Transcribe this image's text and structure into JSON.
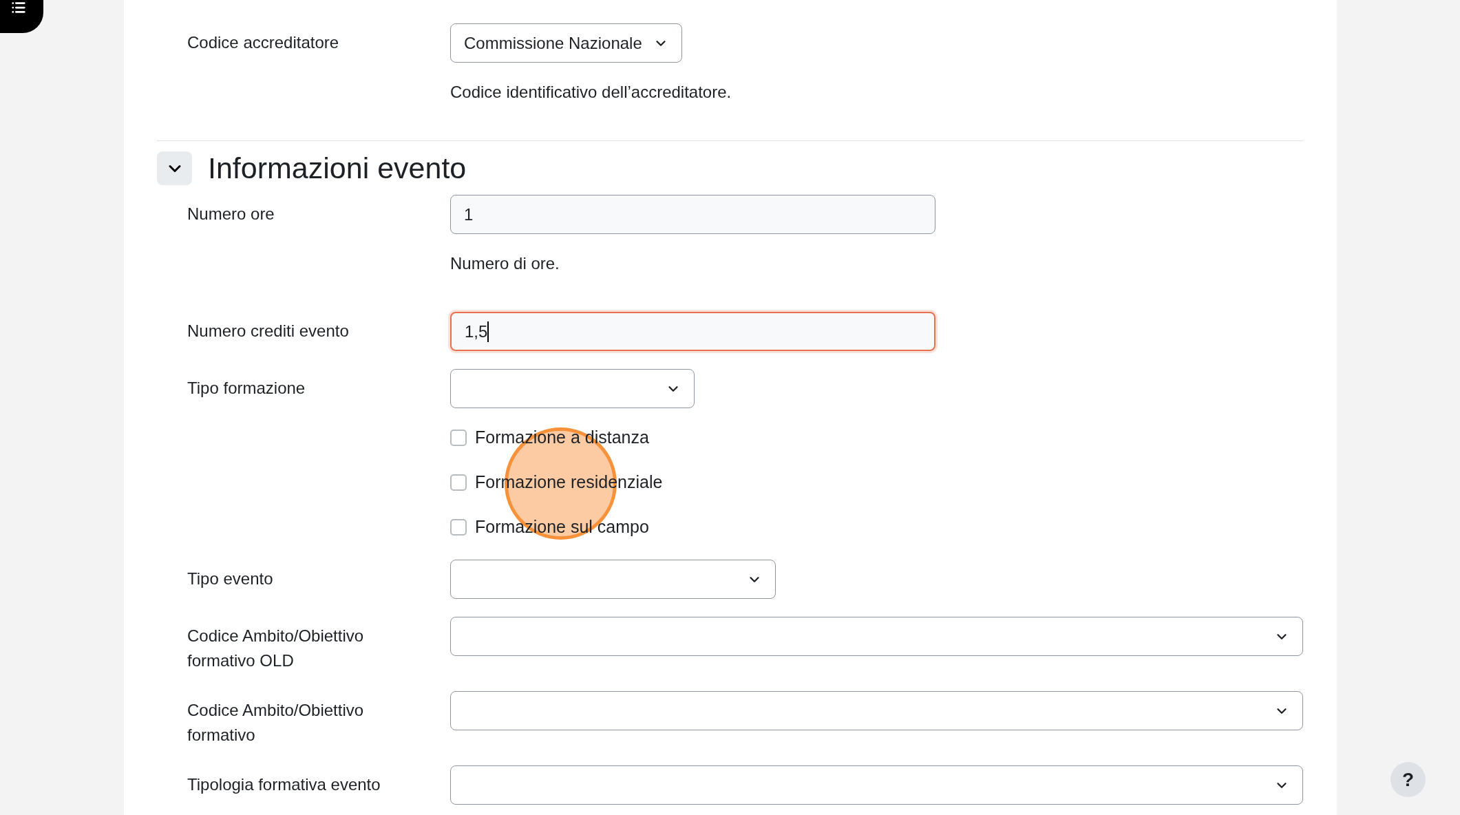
{
  "accreditor": {
    "label": "Codice accreditatore",
    "value": "Commissione Nazionale",
    "help": "Codice identificativo dell’accreditatore."
  },
  "section": {
    "title": "Informazioni evento",
    "expanded": true,
    "fields": [
      {
        "kind": "input",
        "label": "Numero ore",
        "value": "1",
        "help": "Numero di ore.",
        "focused": false
      },
      {
        "kind": "input",
        "label": "Numero crediti evento",
        "value": "1,5",
        "focused": true
      },
      {
        "kind": "select",
        "label": "Tipo formazione",
        "options": [
          {
            "label": "Formazione a distanza",
            "checked": false
          },
          {
            "label": "Formazione residenziale",
            "checked": false
          },
          {
            "label": "Formazione sul campo",
            "checked": false
          }
        ]
      },
      {
        "kind": "select",
        "label": "Tipo evento"
      },
      {
        "kind": "select",
        "label": "Codice Ambito/Obiettivo formativo OLD"
      },
      {
        "kind": "select",
        "label": "Codice Ambito/Obiettivo formativo"
      },
      {
        "kind": "select",
        "label": "Tipologia formativa evento"
      }
    ]
  },
  "help_button": {
    "label": "?"
  }
}
